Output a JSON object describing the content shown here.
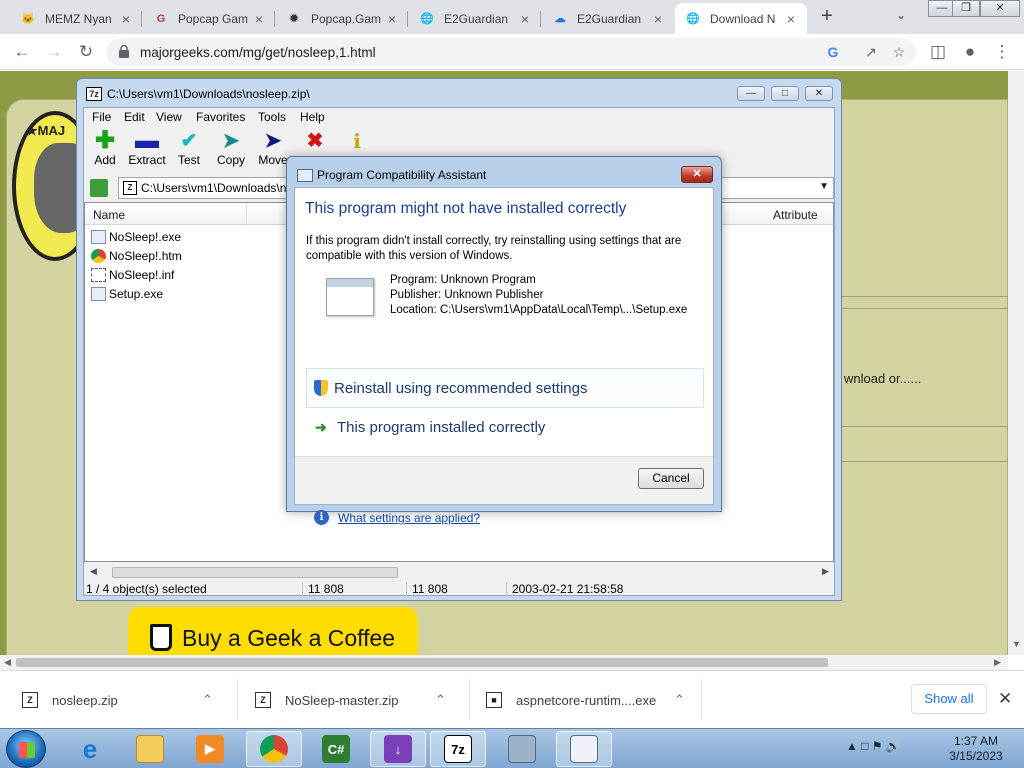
{
  "browser": {
    "tabs": [
      {
        "title": "MEMZ Nyan",
        "icon": "cat-icon"
      },
      {
        "title": "Popcap Gam",
        "icon": "g-logo-icon"
      },
      {
        "title": "Popcap.Gam",
        "icon": "pinwheel-icon"
      },
      {
        "title": "E2Guardian",
        "icon": "globe-icon"
      },
      {
        "title": "E2Guardian",
        "icon": "cloud-icon"
      },
      {
        "title": "Download N",
        "icon": "globe-icon"
      }
    ],
    "url": "majorgeeks.com/mg/get/nosleep,1.html"
  },
  "webpage": {
    "snippet": "wnload or......",
    "coffee_button": "Buy a Geek a Coffee"
  },
  "sevenzip": {
    "title": "C:\\Users\\vm1\\Downloads\\nosleep.zip\\",
    "menu": [
      "File",
      "Edit",
      "View",
      "Favorites",
      "Tools",
      "Help"
    ],
    "tools": [
      {
        "label": "Add",
        "icon": "plus-icon",
        "color": "#16a316"
      },
      {
        "label": "Extract",
        "icon": "minus-icon",
        "color": "#1a24a8"
      },
      {
        "label": "Test",
        "icon": "check-icon",
        "color": "#18b4c8"
      },
      {
        "label": "Copy",
        "icon": "arrow-right-icon",
        "color": "#0f8d8d"
      },
      {
        "label": "Move",
        "icon": "arrow-right-icon",
        "color": "#101a7a"
      },
      {
        "label": "",
        "icon": "delete-icon",
        "color": "#d01515"
      },
      {
        "label": "",
        "icon": "info-icon",
        "color": "#c8a000"
      }
    ],
    "address": "C:\\Users\\vm1\\Downloads\\n",
    "columns": {
      "name": "Name",
      "attributes": "Attribute"
    },
    "files": [
      {
        "name": "NoSleep!.exe",
        "icon": "window-icon"
      },
      {
        "name": "NoSleep!.htm",
        "icon": "chrome-icon"
      },
      {
        "name": "NoSleep!.inf",
        "icon": "config-icon"
      },
      {
        "name": "Setup.exe",
        "icon": "window-icon"
      }
    ],
    "status": {
      "selected": "1 / 4 object(s) selected",
      "size": "11 808",
      "packed": "11 808",
      "modified": "2003-02-21 21:58:58"
    }
  },
  "dialog": {
    "title": "Program Compatibility Assistant",
    "heading": "This program might not have installed correctly",
    "message": "If this program didn't install correctly, try reinstalling using settings that are compatible with this version of Windows.",
    "program": "Program: Unknown Program",
    "publisher": "Publisher: Unknown Publisher",
    "location": "Location: C:\\Users\\vm1\\AppData\\Local\\Temp\\...\\Setup.exe",
    "option_reinstall": "Reinstall using recommended settings",
    "option_correct": "This program installed correctly",
    "cancel": "Cancel",
    "settings_link": "What settings are applied?"
  },
  "downloads": {
    "items": [
      {
        "name": "nosleep.zip"
      },
      {
        "name": "NoSleep-master.zip"
      },
      {
        "name": "aspnetcore-runtim....exe"
      }
    ],
    "show_all": "Show all"
  },
  "taskbar": {
    "time": "1:37 AM",
    "date": "3/15/2023"
  }
}
